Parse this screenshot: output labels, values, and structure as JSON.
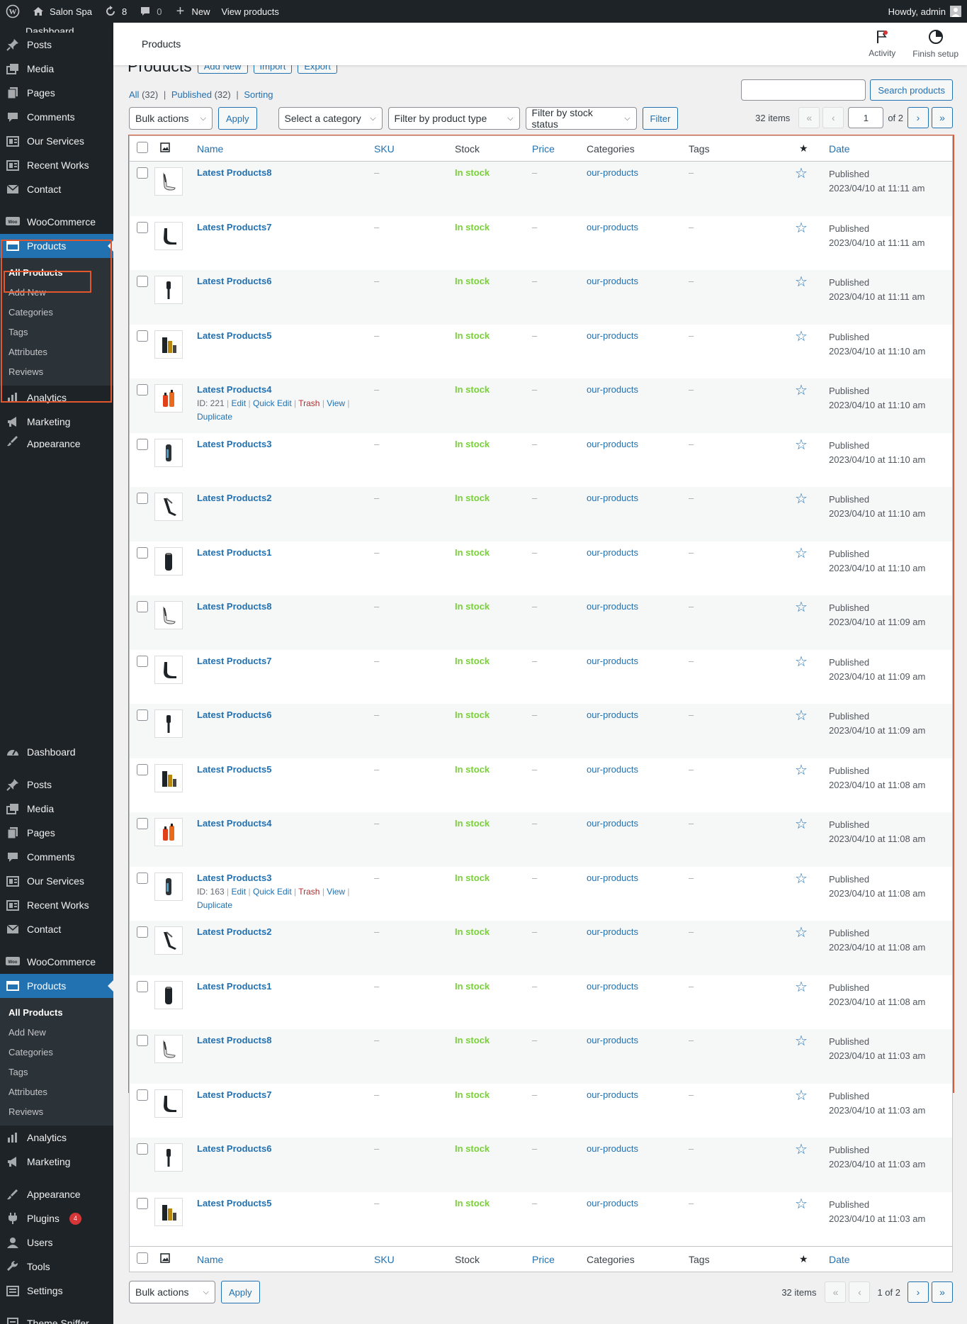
{
  "admin_bar": {
    "site_name": "Salon Spa",
    "updates_count": "8",
    "comments_count": "0",
    "new_label": "New",
    "view_products_label": "View products",
    "howdy": "Howdy, admin"
  },
  "sidebar_top": {
    "partial_label": "Dashboard",
    "items": [
      {
        "label": "Posts",
        "icon": "pin-icon"
      },
      {
        "label": "Media",
        "icon": "media-icon"
      },
      {
        "label": "Pages",
        "icon": "pages-icon"
      },
      {
        "label": "Comments",
        "icon": "comment-icon"
      },
      {
        "label": "Our Services",
        "icon": "services-icon"
      },
      {
        "label": "Recent Works",
        "icon": "works-icon"
      },
      {
        "label": "Contact",
        "icon": "mail-icon"
      }
    ],
    "woocommerce": "WooCommerce",
    "products": "Products",
    "submenu": [
      "All Products",
      "Add New",
      "Categories",
      "Tags",
      "Attributes",
      "Reviews"
    ],
    "after": [
      {
        "label": "Analytics",
        "icon": "bar-chart-icon"
      },
      {
        "label": "Marketing",
        "icon": "megaphone-icon"
      }
    ],
    "appearance_partial": "Appearance"
  },
  "sidebar_bottom": {
    "dashboard": "Dashboard",
    "items": [
      {
        "label": "Posts",
        "icon": "pin-icon"
      },
      {
        "label": "Media",
        "icon": "media-icon"
      },
      {
        "label": "Pages",
        "icon": "pages-icon"
      },
      {
        "label": "Comments",
        "icon": "comment-icon"
      },
      {
        "label": "Our Services",
        "icon": "services-icon"
      },
      {
        "label": "Recent Works",
        "icon": "works-icon"
      },
      {
        "label": "Contact",
        "icon": "mail-icon"
      }
    ],
    "woocommerce": "WooCommerce",
    "products": "Products",
    "submenu": [
      "All Products",
      "Add New",
      "Categories",
      "Tags",
      "Attributes",
      "Reviews"
    ],
    "after": [
      {
        "label": "Analytics",
        "icon": "bar-chart-icon"
      },
      {
        "label": "Marketing",
        "icon": "megaphone-icon"
      }
    ],
    "tail": [
      {
        "label": "Appearance",
        "icon": "brush-icon"
      },
      {
        "label": "Plugins",
        "icon": "plug-icon",
        "badge": "4"
      },
      {
        "label": "Users",
        "icon": "user-icon"
      },
      {
        "label": "Tools",
        "icon": "wrench-icon"
      },
      {
        "label": "Settings",
        "icon": "settings-icon"
      }
    ],
    "theme_sniffer": "Theme Sniffer"
  },
  "page_header": {
    "title": "Products",
    "activity": "Activity",
    "finish_setup": "Finish setup"
  },
  "heading": {
    "title": "Products",
    "add_new": "Add New",
    "import": "Import",
    "export": "Export"
  },
  "views": {
    "all": "All",
    "all_count": "(32)",
    "published": "Published",
    "published_count": "(32)",
    "sorting": "Sorting",
    "sep": "|"
  },
  "search": {
    "button": "Search products",
    "value": ""
  },
  "filters": {
    "bulk_actions": "Bulk actions",
    "apply": "Apply",
    "category": "Select a category",
    "product_type": "Filter by product type",
    "stock_status": "Filter by stock status",
    "filter": "Filter"
  },
  "pagination": {
    "items": "32 items",
    "current_page": "1",
    "of_pages": "of 2",
    "bottom_label": "1 of 2",
    "first": "«",
    "prev": "‹",
    "next": "›",
    "last": "»"
  },
  "columns": {
    "name": "Name",
    "sku": "SKU",
    "stock": "Stock",
    "price": "Price",
    "categories": "Categories",
    "tags": "Tags",
    "featured": "★",
    "date": "Date"
  },
  "products": [
    {
      "name": "Latest Products8",
      "stock": "In stock",
      "category": "our-products",
      "status": "Published",
      "date": "2023/04/10 at 11:11 am",
      "thumb": "comb-icon"
    },
    {
      "name": "Latest Products7",
      "stock": "In stock",
      "category": "our-products",
      "status": "Published",
      "date": "2023/04/10 at 11:11 am",
      "thumb": "hairdryer-icon"
    },
    {
      "name": "Latest Products6",
      "stock": "In stock",
      "category": "our-products",
      "status": "Published",
      "date": "2023/04/10 at 11:11 am",
      "thumb": "brush-icon"
    },
    {
      "name": "Latest Products5",
      "stock": "In stock",
      "category": "our-products",
      "status": "Published",
      "date": "2023/04/10 at 11:10 am",
      "thumb": "bottles-icon"
    },
    {
      "name": "Latest Products4",
      "stock": "In stock",
      "category": "our-products",
      "status": "Published",
      "date": "2023/04/10 at 11:10 am",
      "thumb": "spray-icon",
      "actions": {
        "id": "ID: 221",
        "edit": "Edit",
        "quick_edit": "Quick Edit",
        "trash": "Trash",
        "view": "View",
        "duplicate": "Duplicate"
      }
    },
    {
      "name": "Latest Products3",
      "stock": "In stock",
      "category": "our-products",
      "status": "Published",
      "date": "2023/04/10 at 11:10 am",
      "thumb": "trimmer-icon"
    },
    {
      "name": "Latest Products2",
      "stock": "In stock",
      "category": "our-products",
      "status": "Published",
      "date": "2023/04/10 at 11:10 am",
      "thumb": "straightener-icon"
    },
    {
      "name": "Latest Products1",
      "stock": "In stock",
      "category": "our-products",
      "status": "Published",
      "date": "2023/04/10 at 11:10 am",
      "thumb": "clipper-icon"
    },
    {
      "name": "Latest Products8",
      "stock": "In stock",
      "category": "our-products",
      "status": "Published",
      "date": "2023/04/10 at 11:09 am",
      "thumb": "comb-icon"
    },
    {
      "name": "Latest Products7",
      "stock": "In stock",
      "category": "our-products",
      "status": "Published",
      "date": "2023/04/10 at 11:09 am",
      "thumb": "hairdryer-icon"
    },
    {
      "name": "Latest Products6",
      "stock": "In stock",
      "category": "our-products",
      "status": "Published",
      "date": "2023/04/10 at 11:09 am",
      "thumb": "brush-icon"
    },
    {
      "name": "Latest Products5",
      "stock": "In stock",
      "category": "our-products",
      "status": "Published",
      "date": "2023/04/10 at 11:08 am",
      "thumb": "bottles-icon"
    },
    {
      "name": "Latest Products4",
      "stock": "In stock",
      "category": "our-products",
      "status": "Published",
      "date": "2023/04/10 at 11:08 am",
      "thumb": "spray-icon"
    },
    {
      "name": "Latest Products3",
      "stock": "In stock",
      "category": "our-products",
      "status": "Published",
      "date": "2023/04/10 at 11:08 am",
      "thumb": "trimmer-icon",
      "actions": {
        "id": "ID: 163",
        "edit": "Edit",
        "quick_edit": "Quick Edit",
        "trash": "Trash",
        "view": "View",
        "duplicate": "Duplicate"
      }
    },
    {
      "name": "Latest Products2",
      "stock": "In stock",
      "category": "our-products",
      "status": "Published",
      "date": "2023/04/10 at 11:08 am",
      "thumb": "straightener-icon"
    },
    {
      "name": "Latest Products1",
      "stock": "In stock",
      "category": "our-products",
      "status": "Published",
      "date": "2023/04/10 at 11:08 am",
      "thumb": "clipper-icon"
    },
    {
      "name": "Latest Products8",
      "stock": "In stock",
      "category": "our-products",
      "status": "Published",
      "date": "2023/04/10 at 11:03 am",
      "thumb": "comb-icon"
    },
    {
      "name": "Latest Products7",
      "stock": "In stock",
      "category": "our-products",
      "status": "Published",
      "date": "2023/04/10 at 11:03 am",
      "thumb": "hairdryer-icon"
    },
    {
      "name": "Latest Products6",
      "stock": "In stock",
      "category": "our-products",
      "status": "Published",
      "date": "2023/04/10 at 11:03 am",
      "thumb": "brush-icon"
    },
    {
      "name": "Latest Products5",
      "stock": "In stock",
      "category": "our-products",
      "status": "Published",
      "date": "2023/04/10 at 11:03 am",
      "thumb": "bottles-icon"
    }
  ],
  "dash": "–",
  "colors": {
    "accent": "#2271b1",
    "in_stock": "#7ad03a",
    "highlight": "#e4572e",
    "admin_bg": "#1d2327"
  }
}
